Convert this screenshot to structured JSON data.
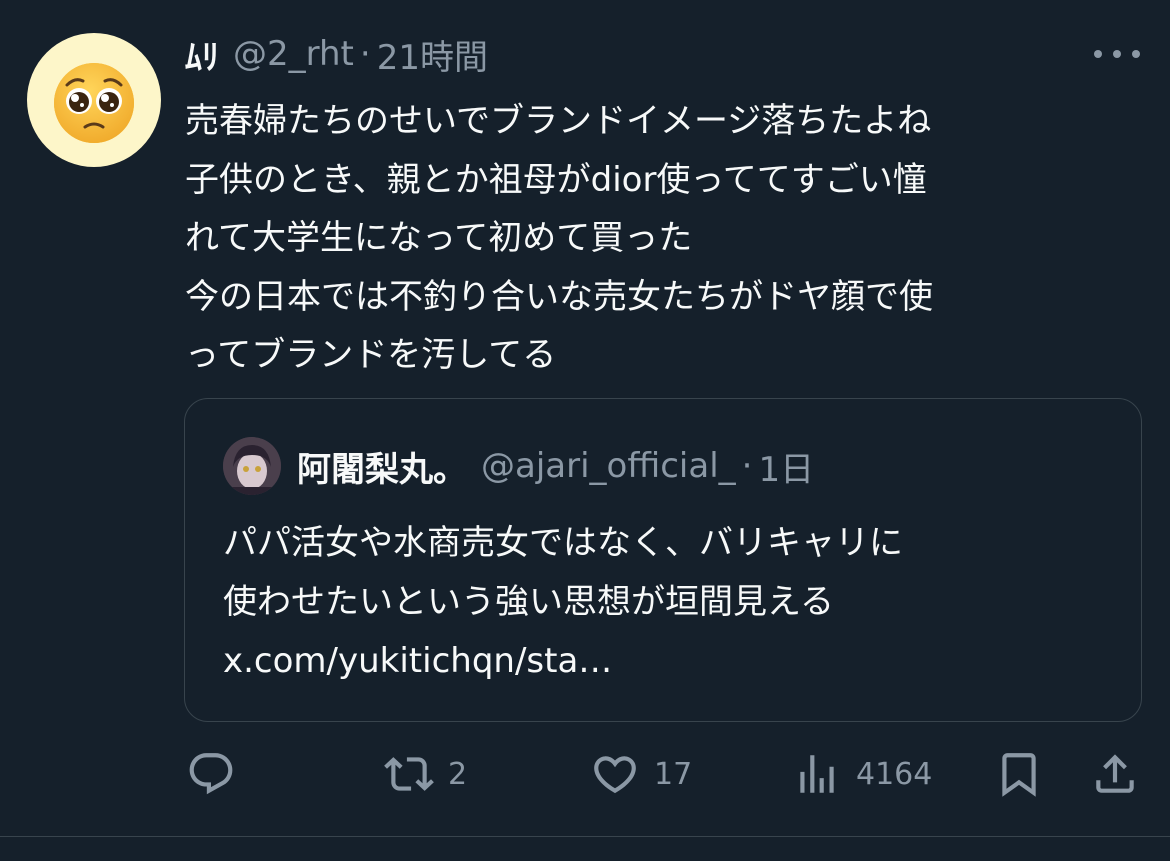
{
  "tweet": {
    "display_name": "ﾑﾘ",
    "handle": "@2_rht",
    "separator": "·",
    "time": "21時間",
    "text_lines": [
      "売春婦たちのせいでブランドイメージ落ちたよね",
      "子供のとき、親とか祖母がdior使っててすごい憧",
      "れて大学生になって初めて買った",
      "今の日本では不釣り合いな売女たちがドヤ顔で使",
      "ってブランドを汚してる"
    ],
    "avatar_icon": "pleading-face-emoji"
  },
  "quote": {
    "display_name": "阿闍梨丸。",
    "handle": "@ajari_official_",
    "separator": "·",
    "time": "1日",
    "text_lines": [
      "パパ活女や水商売女ではなく、バリキャリに",
      "使わせたいという強い思想が垣間見える",
      "x.com/yukitichqn/sta…"
    ]
  },
  "actions": {
    "reply": {
      "icon": "reply-icon",
      "count": ""
    },
    "retweet": {
      "icon": "retweet-icon",
      "count": "2"
    },
    "like": {
      "icon": "heart-icon",
      "count": "17"
    },
    "views": {
      "icon": "views-icon",
      "count": "4164"
    },
    "bookmark": {
      "icon": "bookmark-icon"
    },
    "share": {
      "icon": "share-icon"
    }
  },
  "colors": {
    "background": "#15202b",
    "text": "#f7f9f9",
    "secondary": "#8b98a5",
    "border": "#38444d"
  }
}
